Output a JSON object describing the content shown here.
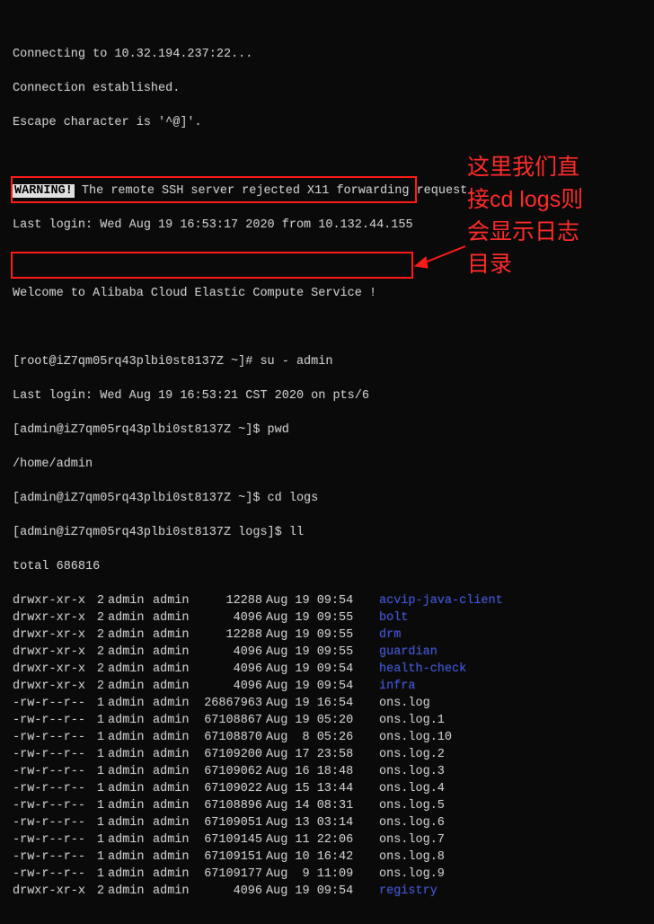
{
  "header": {
    "connecting": "Connecting to 10.32.194.237:22...",
    "established": "Connection established.",
    "escape": "Escape character is '^@]'.",
    "warning_tag": "WARNING!",
    "warning_rest": " The remote SSH server rejected X11 forwarding request.",
    "last_login_root": "Last login: Wed Aug 19 16:53:17 2020 from 10.132.44.155",
    "welcome": "Welcome to Alibaba Cloud Elastic Compute Service !"
  },
  "session": {
    "root_prompt": "[root@iZ7qm05rq43plbi0st8137Z ~]# ",
    "cmd_su": "su - admin",
    "last_login_admin": "Last login: Wed Aug 19 16:53:21 CST 2020 on pts/6",
    "admin_prompt_home": "[admin@iZ7qm05rq43plbi0st8137Z ~]$ ",
    "cmd_pwd": "pwd",
    "pwd_out": "/home/admin",
    "cmd_cd": "cd logs",
    "admin_prompt_logs": "[admin@iZ7qm05rq43plbi0st8137Z logs]$ ",
    "cmd_ll": "ll",
    "total": "total 686816"
  },
  "listing": [
    {
      "perm": "drwxr-xr-x",
      "links": "2",
      "own": "admin",
      "grp": "admin",
      "size": "12288",
      "date": "Aug 19 09:54",
      "name": "acvip-java-client",
      "dir": true
    },
    {
      "perm": "drwxr-xr-x",
      "links": "2",
      "own": "admin",
      "grp": "admin",
      "size": "4096",
      "date": "Aug 19 09:55",
      "name": "bolt",
      "dir": true
    },
    {
      "perm": "drwxr-xr-x",
      "links": "2",
      "own": "admin",
      "grp": "admin",
      "size": "12288",
      "date": "Aug 19 09:55",
      "name": "drm",
      "dir": true
    },
    {
      "perm": "drwxr-xr-x",
      "links": "2",
      "own": "admin",
      "grp": "admin",
      "size": "4096",
      "date": "Aug 19 09:55",
      "name": "guardian",
      "dir": true
    },
    {
      "perm": "drwxr-xr-x",
      "links": "2",
      "own": "admin",
      "grp": "admin",
      "size": "4096",
      "date": "Aug 19 09:54",
      "name": "health-check",
      "dir": true
    },
    {
      "perm": "drwxr-xr-x",
      "links": "2",
      "own": "admin",
      "grp": "admin",
      "size": "4096",
      "date": "Aug 19 09:54",
      "name": "infra",
      "dir": true
    },
    {
      "perm": "-rw-r--r--",
      "links": "1",
      "own": "admin",
      "grp": "admin",
      "size": "26867963",
      "date": "Aug 19 16:54",
      "name": "ons.log",
      "dir": false
    },
    {
      "perm": "-rw-r--r--",
      "links": "1",
      "own": "admin",
      "grp": "admin",
      "size": "67108867",
      "date": "Aug 19 05:20",
      "name": "ons.log.1",
      "dir": false
    },
    {
      "perm": "-rw-r--r--",
      "links": "1",
      "own": "admin",
      "grp": "admin",
      "size": "67108870",
      "date": "Aug  8 05:26",
      "name": "ons.log.10",
      "dir": false
    },
    {
      "perm": "-rw-r--r--",
      "links": "1",
      "own": "admin",
      "grp": "admin",
      "size": "67109200",
      "date": "Aug 17 23:58",
      "name": "ons.log.2",
      "dir": false
    },
    {
      "perm": "-rw-r--r--",
      "links": "1",
      "own": "admin",
      "grp": "admin",
      "size": "67109062",
      "date": "Aug 16 18:48",
      "name": "ons.log.3",
      "dir": false
    },
    {
      "perm": "-rw-r--r--",
      "links": "1",
      "own": "admin",
      "grp": "admin",
      "size": "67109022",
      "date": "Aug 15 13:44",
      "name": "ons.log.4",
      "dir": false
    },
    {
      "perm": "-rw-r--r--",
      "links": "1",
      "own": "admin",
      "grp": "admin",
      "size": "67108896",
      "date": "Aug 14 08:31",
      "name": "ons.log.5",
      "dir": false
    },
    {
      "perm": "-rw-r--r--",
      "links": "1",
      "own": "admin",
      "grp": "admin",
      "size": "67109051",
      "date": "Aug 13 03:14",
      "name": "ons.log.6",
      "dir": false
    },
    {
      "perm": "-rw-r--r--",
      "links": "1",
      "own": "admin",
      "grp": "admin",
      "size": "67109145",
      "date": "Aug 11 22:06",
      "name": "ons.log.7",
      "dir": false
    },
    {
      "perm": "-rw-r--r--",
      "links": "1",
      "own": "admin",
      "grp": "admin",
      "size": "67109151",
      "date": "Aug 10 16:42",
      "name": "ons.log.8",
      "dir": false
    },
    {
      "perm": "-rw-r--r--",
      "links": "1",
      "own": "admin",
      "grp": "admin",
      "size": "67109177",
      "date": "Aug  9 11:09",
      "name": "ons.log.9",
      "dir": false
    },
    {
      "perm": "drwxr-xr-x",
      "links": "2",
      "own": "admin",
      "grp": "admin",
      "size": "4096",
      "date": "Aug 19 09:54",
      "name": "registry",
      "dir": true
    }
  ],
  "annotation": {
    "text": "这里我们直\n接cd logs则\n会显示日志\n目录"
  }
}
